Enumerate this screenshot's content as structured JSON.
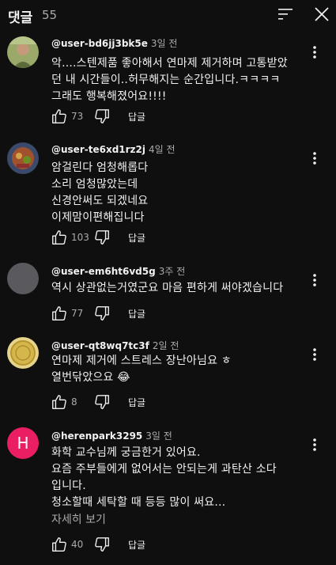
{
  "header": {
    "title": "댓글",
    "count": "55",
    "sort_icon": "sort-icon",
    "close_icon": "close-icon"
  },
  "comments": [
    {
      "author": "@user-bd6jj3bk5e",
      "time": "3일 전",
      "text": "악....스텐제품 좋아해서 연마제 제거하며 고통받았\n던 내 시간들이..허무해지는 순간입니다.ㅋㅋㅋㅋ\n그래도 행복해졌어요!!!!",
      "likes": "73",
      "reply": "답글",
      "avatar_color": "#8a9a5b"
    },
    {
      "author": "@user-te6xd1rz2j",
      "time": "4일 전",
      "text": "암걸린다 엄청해롭다\n소리 엄청많았는데\n신경안써도 되겠네요\n이제맘이편해집니다",
      "likes": "103",
      "reply": "답글",
      "avatar_color": "#8b5a3c"
    },
    {
      "author": "@user-em6ht6vd5g",
      "time": "3주 전",
      "text": "역시 상관없는거였군요 마음 편하게 써야겠습니다",
      "likes": "77",
      "reply": "답글",
      "avatar_color": "#5a5a5e"
    },
    {
      "author": "@user-qt8wq7tc3f",
      "time": "2일 전",
      "text": "연마제 제거에 스트레스 장난아님요 ㅎ\n열번닦았으요 😂",
      "likes": "8",
      "reply": "답글",
      "avatar_color": "#d4b64a"
    },
    {
      "author": "@herenpark3295",
      "time": "3일 전",
      "text": "화학 교수님께 궁금한거 있어요.\n요즘 주부들에게 없어서는 안되는게 과탄산 소다\n입니다.\n청소할때 세탁할 때 등등 많이 써요...",
      "read_more": "자세히 보기",
      "likes": "40",
      "reply": "답글",
      "avatar_letter": "H",
      "avatar_color": "#e91e63"
    }
  ]
}
